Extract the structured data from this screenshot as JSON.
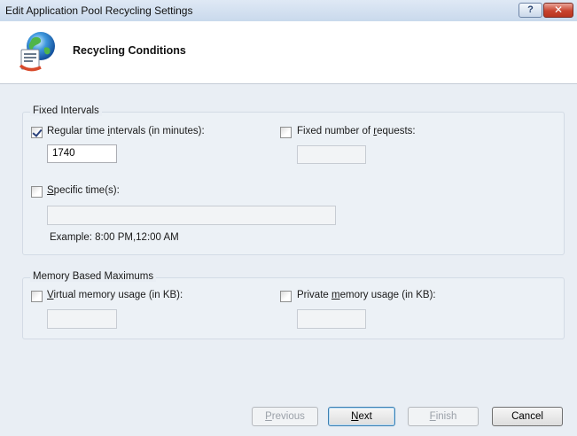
{
  "window": {
    "title": "Edit Application Pool Recycling Settings",
    "help_label": "?",
    "close_label": "✕"
  },
  "header": {
    "title": "Recycling Conditions",
    "icon": "recycle-settings-icon"
  },
  "fixed_intervals": {
    "group_title": "Fixed Intervals",
    "regular": {
      "label_pre": "Regular time ",
      "label_accel": "i",
      "label_post": "ntervals (in minutes):",
      "checked": true,
      "value": "1740"
    },
    "requests": {
      "label_pre": "Fixed number of ",
      "label_accel": "r",
      "label_post": "equests:",
      "checked": false,
      "value": ""
    },
    "specific": {
      "label_pre": "",
      "label_accel": "S",
      "label_post": "pecific time(s):",
      "checked": false,
      "value": "",
      "example": "Example: 8:00 PM,12:00 AM"
    }
  },
  "memory": {
    "group_title": "Memory Based Maximums",
    "virtual": {
      "label_pre": "",
      "label_accel": "V",
      "label_post": "irtual memory usage (in KB):",
      "checked": false,
      "value": ""
    },
    "private": {
      "label_pre": "Private ",
      "label_accel": "m",
      "label_post": "emory usage (in KB):",
      "checked": false,
      "value": ""
    }
  },
  "buttons": {
    "previous": {
      "label_accel": "P",
      "label_post": "revious",
      "enabled": false
    },
    "next": {
      "label_accel": "N",
      "label_post": "ext",
      "enabled": true
    },
    "finish": {
      "label_accel": "F",
      "label_post": "inish",
      "enabled": false
    },
    "cancel": {
      "label": "Cancel",
      "enabled": true
    }
  }
}
